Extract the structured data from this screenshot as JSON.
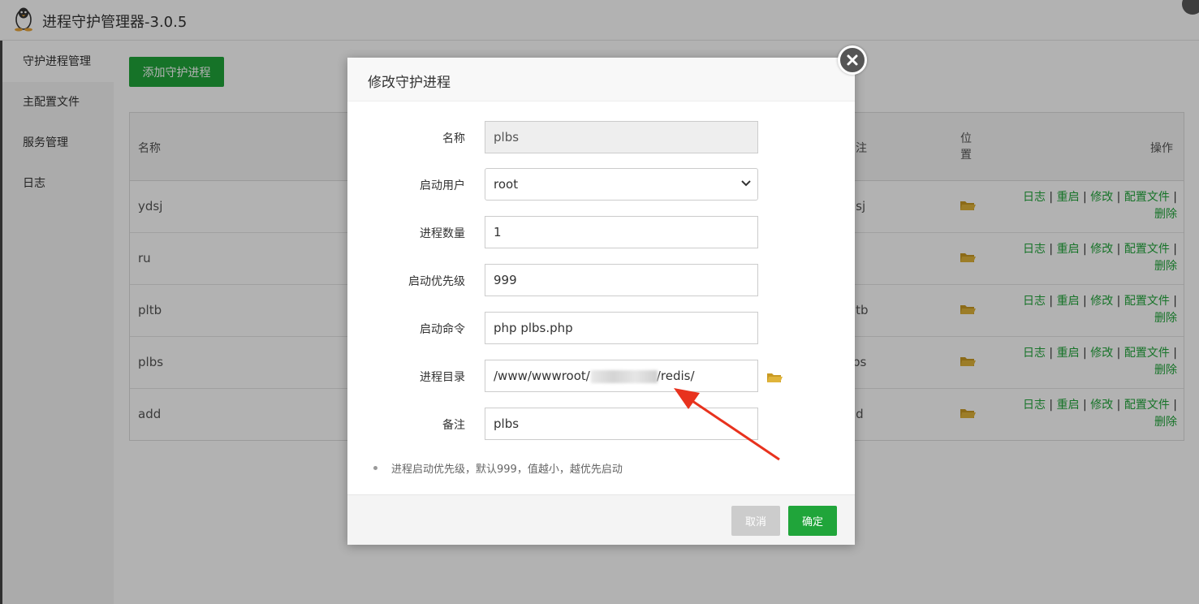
{
  "app": {
    "title": "进程守护管理器-3.0.5",
    "logo_icon": "penguin-icon"
  },
  "sidebar": {
    "items": [
      {
        "label": "守护进程管理",
        "active": true
      },
      {
        "label": "主配置文件"
      },
      {
        "label": "服务管理"
      },
      {
        "label": "日志"
      }
    ]
  },
  "toolbar": {
    "add_label": "添加守护进程"
  },
  "table": {
    "headers": {
      "name": "名称",
      "remark": "注",
      "location": "位置",
      "ops": "操作"
    },
    "rows": [
      {
        "name": "ydsj",
        "remark": "lsj"
      },
      {
        "name": "ru",
        "remark": ""
      },
      {
        "name": "pltb",
        "remark": "ltb"
      },
      {
        "name": "plbs",
        "remark": "bs"
      },
      {
        "name": "add",
        "remark": "ld"
      }
    ],
    "ops": {
      "log": "日志",
      "restart": "重启",
      "edit": "修改",
      "config": "配置文件",
      "delete": "删除",
      "sep": "|"
    }
  },
  "modal": {
    "title": "修改守护进程",
    "fields": {
      "name": {
        "label": "名称",
        "value": "plbs"
      },
      "user": {
        "label": "启动用户",
        "value": "root"
      },
      "count": {
        "label": "进程数量",
        "value": "1"
      },
      "priority": {
        "label": "启动优先级",
        "value": "999"
      },
      "command": {
        "label": "启动命令",
        "value": "php plbs.php"
      },
      "dir": {
        "label": "进程目录",
        "value_prefix": "/www/wwwroot/",
        "value_suffix": "/redis/"
      },
      "remark": {
        "label": "备注",
        "value": "plbs"
      }
    },
    "tip": "进程启动优先级，默认999，值越小，越优先启动",
    "cancel_label": "取消",
    "ok_label": "确定"
  },
  "colors": {
    "accent": "#20a53a",
    "folder": "#e0b43a",
    "arrow": "#e8321e"
  }
}
